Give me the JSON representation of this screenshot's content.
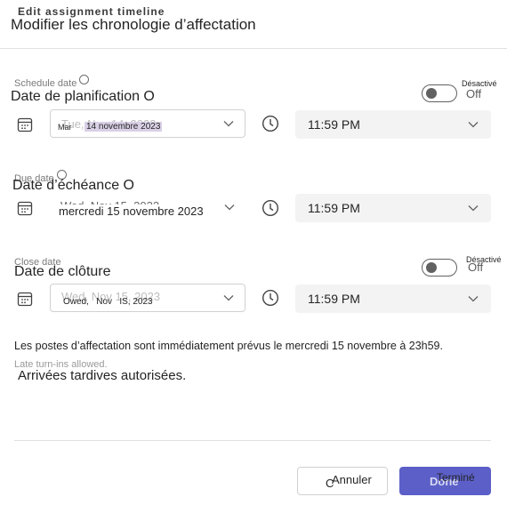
{
  "dialog": {
    "title": "Modifier les chronologie d’affectation",
    "title_ghost": "Edit assignment timeline"
  },
  "schedule": {
    "label": "Date de planification O",
    "ghost_label": "Schedule date",
    "toggle_small_label": "Désactivé",
    "toggle_state_label": "Off",
    "date_ghost": "Tue, Nov 14, 2023",
    "date_prefix": "Mar",
    "date_value": "14 novembre 2023",
    "time_value": "11:59 PM",
    "toggle_on": false
  },
  "due": {
    "label": "Date d’échéance O",
    "ghost_label": "Due date",
    "date_ghost": "Wed, Nov 15, 2023",
    "date_value": "mercredi 15 novembre 2023",
    "time_value": "11:59 PM"
  },
  "close": {
    "label": "Date de clôture",
    "ghost_label": "Close date",
    "toggle_small_label": "Désactivé",
    "toggle_state_label": "Off",
    "date_ghost": "Wed, Nov 15, 2023",
    "date_value": "Owed,   Nov   IS, 2023",
    "time_value": "11:59 PM",
    "toggle_on": false
  },
  "notes": {
    "posting": "Les postes d’affectation sont immédiatement prévus le mercredi 15 novembre à 23h59.",
    "late_ghost": "Late turn-ins allowed.",
    "late": "Arrivées tardives autorisées."
  },
  "buttons": {
    "cancel_label": "Annuler",
    "cancel_prefix": "C",
    "done_ghost": "Done",
    "done_label": "Terminé"
  },
  "colors": {
    "accent": "#5b5fc7",
    "field_bg": "#f3f3f3",
    "border": "#d1d1d1"
  }
}
